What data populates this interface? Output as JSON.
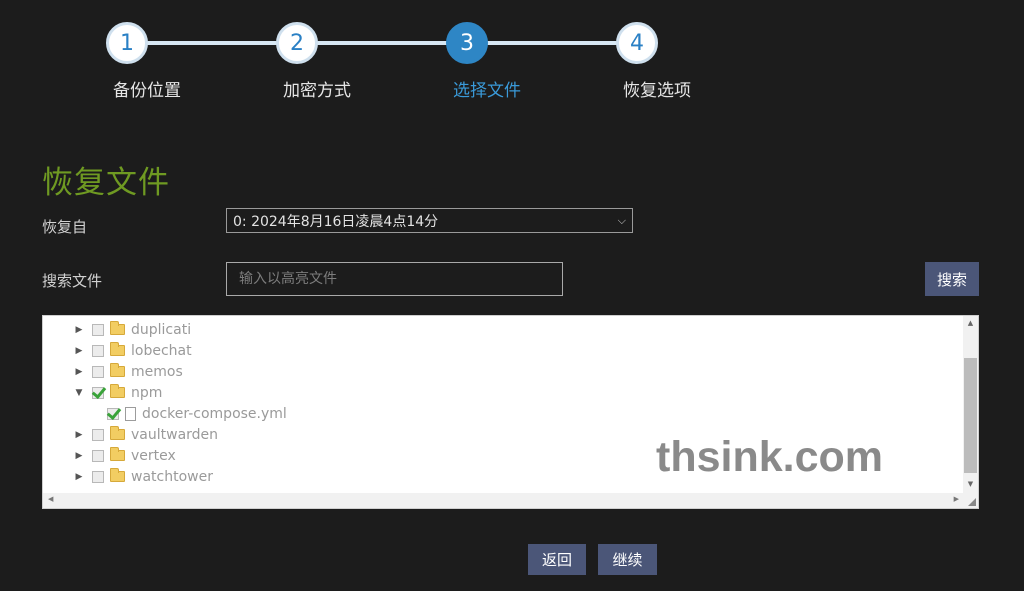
{
  "stepper": {
    "steps": [
      {
        "number": "1",
        "label": "备份位置"
      },
      {
        "number": "2",
        "label": "加密方式"
      },
      {
        "number": "3",
        "label": "选择文件"
      },
      {
        "number": "4",
        "label": "恢复选项"
      }
    ],
    "active_step": 3
  },
  "page_title": "恢复文件",
  "restore_from": {
    "label": "恢复自",
    "selected": "0: 2024年8月16日凌晨4点14分"
  },
  "search": {
    "label": "搜索文件",
    "placeholder": "输入以高亮文件",
    "button_label": "搜索"
  },
  "tree": {
    "items": [
      {
        "name": "duplicati",
        "type": "folder",
        "expanded": false,
        "checked": false
      },
      {
        "name": "lobechat",
        "type": "folder",
        "expanded": false,
        "checked": false
      },
      {
        "name": "memos",
        "type": "folder",
        "expanded": false,
        "checked": false
      },
      {
        "name": "npm",
        "type": "folder",
        "expanded": true,
        "checked": true
      },
      {
        "name": "docker-compose.yml",
        "type": "file",
        "checked": true
      },
      {
        "name": "vaultwarden",
        "type": "folder",
        "expanded": false,
        "checked": false
      },
      {
        "name": "vertex",
        "type": "folder",
        "expanded": false,
        "checked": false
      },
      {
        "name": "watchtower",
        "type": "folder",
        "expanded": false,
        "checked": false
      }
    ]
  },
  "watermark": "thsink.com",
  "footer": {
    "back_label": "返回",
    "continue_label": "继续"
  },
  "colors": {
    "background": "#1c1c1c",
    "title_green": "#6f9a22",
    "active_step": "#2e86c5",
    "button": "#4b5678"
  }
}
